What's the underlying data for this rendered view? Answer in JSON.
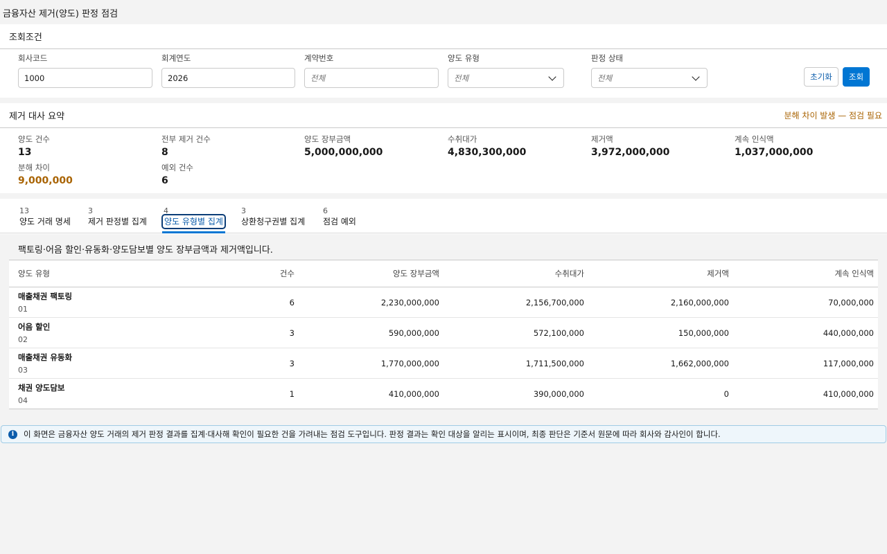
{
  "page": {
    "title": "금융자산 제거(양도) 판정 점검"
  },
  "filter": {
    "title": "조회조건",
    "company_code": {
      "label": "회사코드",
      "value": "1000"
    },
    "fiscal_year": {
      "label": "회계연도",
      "value": "2026"
    },
    "contract_no": {
      "label": "계약번호",
      "placeholder": "전체"
    },
    "transfer_type": {
      "label": "양도 유형",
      "value": "전체"
    },
    "judgment_status": {
      "label": "판정 상태",
      "value": "전체"
    },
    "reset_label": "초기화",
    "search_label": "조회"
  },
  "summary": {
    "title": "제거 대사 요약",
    "warning": "분해 차이 발생 — 점검 필요",
    "metrics": {
      "transfer_count": {
        "label": "양도 건수",
        "value": "13"
      },
      "full_derecog_count": {
        "label": "전부 제거 건수",
        "value": "8"
      },
      "book_amount": {
        "label": "양도 장부금액",
        "value": "5,000,000,000"
      },
      "consideration": {
        "label": "수취대가",
        "value": "4,830,300,000"
      },
      "derecog_amount": {
        "label": "제거액",
        "value": "3,972,000,000"
      },
      "continuing_amount": {
        "label": "계속 인식액",
        "value": "1,037,000,000"
      },
      "breakdown_diff": {
        "label": "분해 차이",
        "value": "9,000,000"
      },
      "exception_count": {
        "label": "예외 건수",
        "value": "6"
      }
    }
  },
  "tabs": [
    {
      "count": "13",
      "label": "양도 거래 명세"
    },
    {
      "count": "3",
      "label": "제거 판정별 집계"
    },
    {
      "count": "4",
      "label": "양도 유형별 집계"
    },
    {
      "count": "3",
      "label": "상환청구권별 집계"
    },
    {
      "count": "6",
      "label": "점검 예외"
    }
  ],
  "tab_body": {
    "description": "팩토링·어음 할인·유동화·양도담보별 양도 장부금액과 제거액입니다.",
    "columns": [
      "양도 유형",
      "건수",
      "양도 장부금액",
      "수취대가",
      "제거액",
      "계속 인식액"
    ],
    "rows": [
      {
        "name": "매출채권 팩토링",
        "code": "01",
        "count": "6",
        "book": "2,230,000,000",
        "consideration": "2,156,700,000",
        "derecog": "2,160,000,000",
        "continuing": "70,000,000"
      },
      {
        "name": "어음 할인",
        "code": "02",
        "count": "3",
        "book": "590,000,000",
        "consideration": "572,100,000",
        "derecog": "150,000,000",
        "continuing": "440,000,000"
      },
      {
        "name": "매출채권 유동화",
        "code": "03",
        "count": "3",
        "book": "1,770,000,000",
        "consideration": "1,711,500,000",
        "derecog": "1,662,000,000",
        "continuing": "117,000,000"
      },
      {
        "name": "채권 양도담보",
        "code": "04",
        "count": "1",
        "book": "410,000,000",
        "consideration": "390,000,000",
        "derecog": "0",
        "continuing": "410,000,000"
      }
    ]
  },
  "info_banner": {
    "icon": "info-icon",
    "text": "이 화면은 금융자산 양도 거래의 제거 판정 결과를 집계·대사해 확인이 필요한 건을 가려내는 점검 도구입니다. 판정 결과는 확인 대상을 알리는 표시이며, 최종 판단은 기준서 원문에 따라 회사와 감사인이 합니다."
  },
  "colors": {
    "brand": "#0176d3",
    "warning": "#a96404",
    "info_bg": "#eef6fb"
  }
}
